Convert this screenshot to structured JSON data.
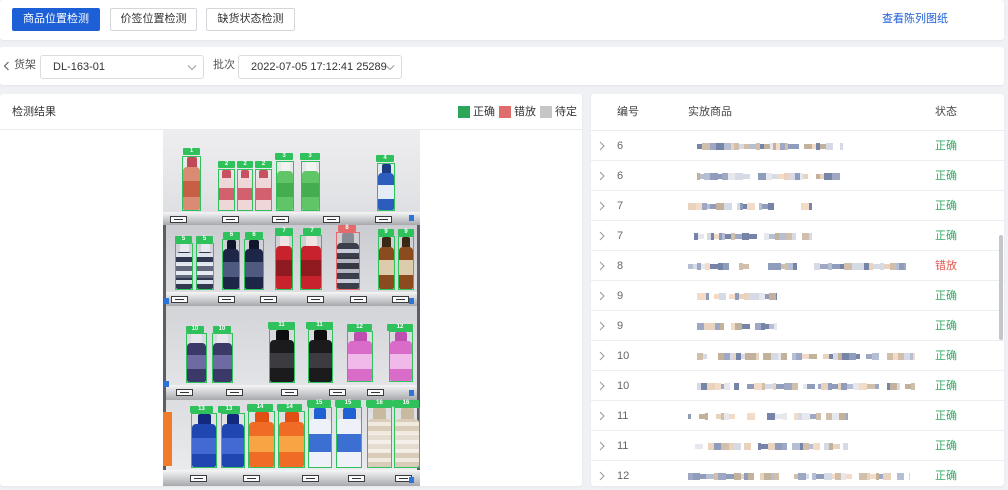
{
  "toolbar": {
    "tabs": [
      {
        "label": "商品位置检测"
      },
      {
        "label": "价签位置检测"
      },
      {
        "label": "缺货状态检测"
      }
    ],
    "active_tab": 0,
    "view_link": "查看陈列图纸"
  },
  "filters": {
    "back_icon": "chevron-left-icon",
    "shelf_label": "货架",
    "shelf_value": "DL-163-01",
    "batch_label": "批次",
    "batch_value": "2022-07-05 17:12:41 25289",
    "dropdown_icon": "chevron-down-icon"
  },
  "result_panel": {
    "title": "检测结果",
    "legend": [
      {
        "label": "正确",
        "color": "#2ca55a"
      },
      {
        "label": "错放",
        "color": "#e06b6b"
      },
      {
        "label": "待定",
        "color": "#c6c6c6"
      }
    ],
    "detections": [
      {
        "label": "1",
        "color": "#2fc15b"
      },
      {
        "label": "2",
        "color": "#2fc15b"
      },
      {
        "label": "2",
        "color": "#2fc15b"
      },
      {
        "label": "2",
        "color": "#2fc15b"
      },
      {
        "label": "3",
        "color": "#2fc15b"
      },
      {
        "label": "3",
        "color": "#2fc15b"
      },
      {
        "label": "4",
        "color": "#2fc15b"
      },
      {
        "label": "5",
        "color": "#2fc15b"
      },
      {
        "label": "5",
        "color": "#2fc15b"
      },
      {
        "label": "6",
        "color": "#2fc15b"
      },
      {
        "label": "6",
        "color": "#2fc15b"
      },
      {
        "label": "7",
        "color": "#2fc15b"
      },
      {
        "label": "7",
        "color": "#2fc15b"
      },
      {
        "label": "8",
        "color": "#e56a6a"
      },
      {
        "label": "9",
        "color": "#2fc15b"
      },
      {
        "label": "9",
        "color": "#2fc15b"
      },
      {
        "label": "10",
        "color": "#2fc15b"
      },
      {
        "label": "10",
        "color": "#2fc15b"
      },
      {
        "label": "11",
        "color": "#2fc15b"
      },
      {
        "label": "11",
        "color": "#2fc15b"
      },
      {
        "label": "12",
        "color": "#2fc15b"
      },
      {
        "label": "12",
        "color": "#2fc15b"
      },
      {
        "label": "13",
        "color": "#2fc15b"
      },
      {
        "label": "13",
        "color": "#2fc15b"
      },
      {
        "label": "14",
        "color": "#2fc15b"
      },
      {
        "label": "14",
        "color": "#2fc15b"
      },
      {
        "label": "15",
        "color": "#2fc15b"
      },
      {
        "label": "15",
        "color": "#2fc15b"
      },
      {
        "label": "16",
        "color": "#2fc15b"
      },
      {
        "label": "16",
        "color": "#2fc15b"
      }
    ]
  },
  "table": {
    "headers": {
      "id": "编号",
      "product": "实放商品",
      "status": "状态"
    },
    "row_icon": "chevron-right-icon",
    "rows": [
      {
        "id": "6",
        "status": "正确",
        "status_color": "#36a862"
      },
      {
        "id": "6",
        "status": "正确",
        "status_color": "#36a862"
      },
      {
        "id": "7",
        "status": "正确",
        "status_color": "#36a862"
      },
      {
        "id": "7",
        "status": "正确",
        "status_color": "#36a862"
      },
      {
        "id": "8",
        "status": "错放",
        "status_color": "#e2564f"
      },
      {
        "id": "9",
        "status": "正确",
        "status_color": "#36a862"
      },
      {
        "id": "9",
        "status": "正确",
        "status_color": "#36a862"
      },
      {
        "id": "10",
        "status": "正确",
        "status_color": "#36a862"
      },
      {
        "id": "10",
        "status": "正确",
        "status_color": "#36a862"
      },
      {
        "id": "11",
        "status": "正确",
        "status_color": "#36a862"
      },
      {
        "id": "11",
        "status": "正确",
        "status_color": "#36a862"
      },
      {
        "id": "12",
        "status": "正确",
        "status_color": "#36a862"
      }
    ]
  },
  "colors": {
    "primary": "#1d5fd6",
    "page_bg": "#eff1f4"
  }
}
